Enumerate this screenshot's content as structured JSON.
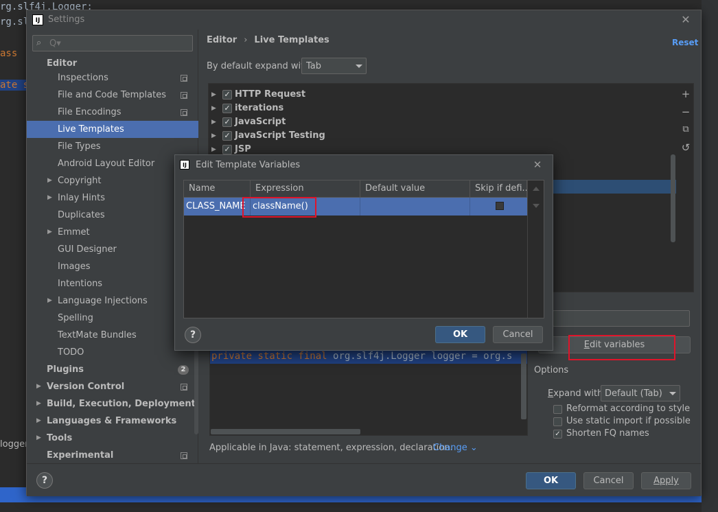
{
  "background": {
    "line1": "rg.slf4j.Logger;",
    "line2": "rg.slf",
    "line3": "ass",
    "line4": "ate s",
    "line5": "logger"
  },
  "settings": {
    "title": "Settings",
    "search_placeholder": "Q▾",
    "nav": {
      "editor": "Editor",
      "inspections": "Inspections",
      "file_code_templates": "File and Code Templates",
      "file_encodings": "File Encodings",
      "live_templates": "Live Templates",
      "file_types": "File Types",
      "android_layout_editor": "Android Layout Editor",
      "copyright": "Copyright",
      "inlay_hints": "Inlay Hints",
      "duplicates": "Duplicates",
      "emmet": "Emmet",
      "gui_designer": "GUI Designer",
      "images": "Images",
      "intentions": "Intentions",
      "language_injections": "Language Injections",
      "spelling": "Spelling",
      "textmate_bundles": "TextMate Bundles",
      "todo": "TODO",
      "plugins": "Plugins",
      "plugins_badge": "2",
      "version_control": "Version Control",
      "build_execution": "Build, Execution, Deployment",
      "languages_frameworks": "Languages & Frameworks",
      "tools": "Tools",
      "experimental": "Experimental"
    },
    "breadcrumb": [
      "Editor",
      "›",
      "Live Templates"
    ],
    "reset": "Reset",
    "expand_label": "By default expand with",
    "expand_value": "Tab",
    "template_groups": [
      "HTTP Request",
      "iterations",
      "JavaScript",
      "JavaScript Testing",
      "JSP"
    ],
    "tools": {
      "add": "+",
      "remove": "−",
      "copy": "⧉",
      "restore": "↺"
    },
    "edit_variables_prefix": "E",
    "edit_variables_rest": "dit variables",
    "code_keywords": "private static final ",
    "code_rest": "org.slf4j.Logger logger = org.s",
    "applicable": "Applicable in Java: statement, expression, declaration.",
    "change": "Change ⌄",
    "options": {
      "title": "Options",
      "expand_with_prefix": "E",
      "expand_with_rest": "xpand with",
      "expand_with_value": "Default (Tab)",
      "reformat": "Reformat according to style",
      "static_import": "Use static import if possible",
      "shorten_fq": "Shorten FQ names",
      "checkmark": "✓"
    },
    "footer": {
      "help": "?",
      "ok": "OK",
      "cancel": "Cancel",
      "apply": "Apply"
    }
  },
  "dialog": {
    "title": "Edit Template Variables",
    "close": "✕",
    "columns": [
      "Name",
      "Expression",
      "Default value",
      "Skip if defi..."
    ],
    "row": {
      "name": "CLASS_NAME",
      "expression": "className()",
      "default_value": ""
    },
    "help": "?",
    "ok": "OK",
    "cancel": "Cancel"
  }
}
